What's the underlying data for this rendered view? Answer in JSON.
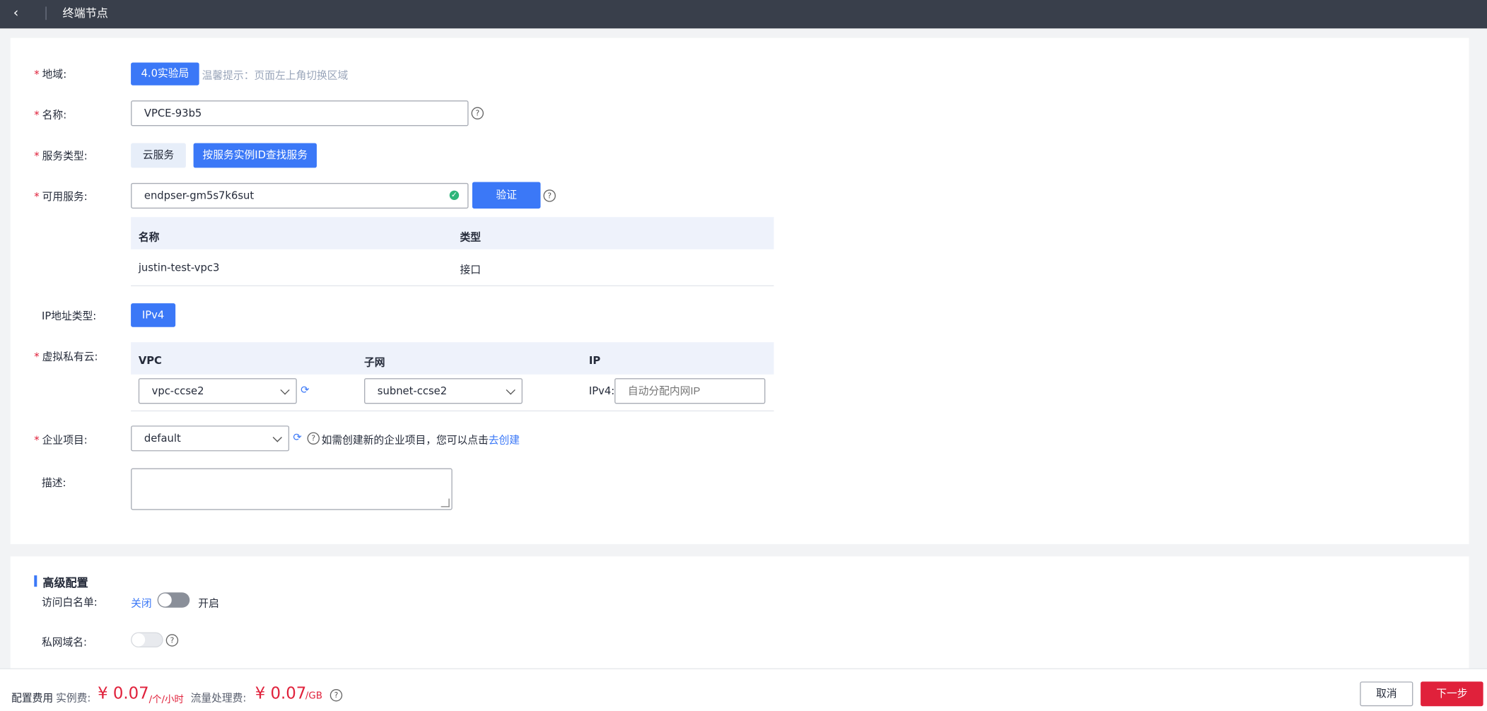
{
  "header": {
    "back_icon": "chevron-left-icon",
    "title": "终端节点"
  },
  "form": {
    "region": {
      "label": "地域:",
      "button": "4.0实验局",
      "hint": "温馨提示：页面左上角切换区域"
    },
    "name": {
      "label": "名称:",
      "value": "VPCE-93b5"
    },
    "service_type": {
      "label": "服务类型:",
      "options": [
        "云服务",
        "按服务实例ID查找服务"
      ],
      "selected": "按服务实例ID查找服务"
    },
    "available_service": {
      "label": "可用服务:",
      "value": "endpser-gm5s7k6sut",
      "verify_button": "验证",
      "table": {
        "headers": [
          "名称",
          "类型"
        ],
        "rows": [
          [
            "justin-test-vpc3",
            "接口"
          ]
        ]
      }
    },
    "ip_type": {
      "label": "IP地址类型:",
      "value": "IPv4"
    },
    "vpc": {
      "label": "虚拟私有云:",
      "headers": [
        "VPC",
        "子网",
        "IP"
      ],
      "vpc_value": "vpc-ccse2",
      "subnet_value": "subnet-ccse2",
      "ip_prefix": "IPv4:",
      "ip_placeholder": "自动分配内网IP"
    },
    "enterprise": {
      "label": "企业项目:",
      "value": "default",
      "hint": "如需创建新的企业项目，您可以点击",
      "link": "去创建"
    },
    "description": {
      "label": "描述:",
      "value": ""
    }
  },
  "advanced": {
    "title": "高级配置",
    "whitelist": {
      "label": "访问白名单:",
      "off": "关闭",
      "on": "开启",
      "enabled": false
    },
    "private_dns": {
      "label": "私网域名:",
      "enabled": false
    }
  },
  "footer": {
    "label": "配置费用",
    "instance_label": "实例费:",
    "instance_price": "¥ 0.07",
    "instance_unit": "/个/小时",
    "traffic_label": "流量处理费:",
    "traffic_price": "¥ 0.07",
    "traffic_unit": "/GB",
    "cancel": "取消",
    "next": "下一步"
  },
  "colors": {
    "primary": "#3b78f7",
    "danger": "#e0213b",
    "header_bg": "#393f4b",
    "success": "#2eb57a"
  }
}
